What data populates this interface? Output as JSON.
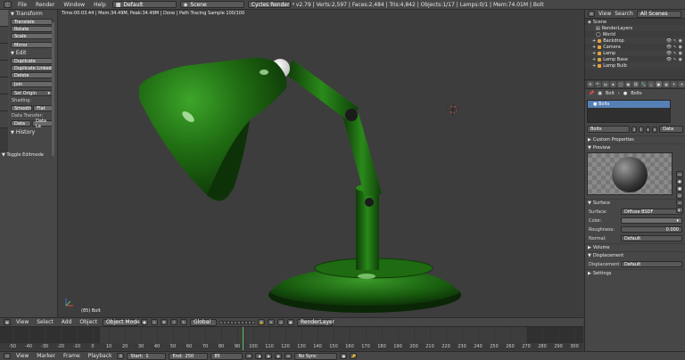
{
  "top": {
    "menu": [
      "File",
      "Render",
      "Window",
      "Help"
    ],
    "screen_layout": "Default",
    "scene": "Scene",
    "engine": "Cycles Render",
    "stats": "v2.79 | Verts:2,597 | Faces:2,484 | Tris:4,842 | Objects:1/17 | Lamps:0/1 | Mem:74.01M | Bolt"
  },
  "toolshelf": {
    "transform_head": "Transform",
    "translate": "Translate",
    "rotate": "Rotate",
    "scale": "Scale",
    "mirror": "Mirror",
    "edit_head": "Edit",
    "duplicate": "Duplicate",
    "duplicate_linked": "Duplicate Linked",
    "delete": "Delete",
    "join": "Join",
    "set_origin": "Set Origin",
    "shading": "Shading:",
    "smooth": "Smooth",
    "flat": "Flat",
    "data_transfer": "Data Transfer:",
    "data": "Data",
    "data_layout": "Data La",
    "history_head": "History",
    "toggle_editmode": "Toggle Editmode"
  },
  "viewport": {
    "info": "Time:00:03.44 | Mem:34.49M, Peak:34.49M | Done | Path Tracing Sample 100/100",
    "object_label": "(85) Bolt"
  },
  "header3d": {
    "view": "View",
    "select": "Select",
    "add": "Add",
    "object": "Object",
    "mode": "Object Mode",
    "orientation": "Global",
    "render_layer": "RenderLayer"
  },
  "timeline": {
    "ticks": [
      "-50",
      "-40",
      "-30",
      "-20",
      "-10",
      "0",
      "10",
      "20",
      "30",
      "40",
      "50",
      "60",
      "70",
      "80",
      "90",
      "100",
      "110",
      "120",
      "130",
      "140",
      "150",
      "160",
      "170",
      "180",
      "190",
      "200",
      "210",
      "220",
      "230",
      "240",
      "250",
      "260",
      "270",
      "280",
      "290",
      "300"
    ]
  },
  "bottom": {
    "view": "View",
    "marker": "Marker",
    "frame": "Frame",
    "playback": "Playback",
    "start_label": "Start:",
    "start": "1",
    "end_label": "End:",
    "end": "250",
    "current": "85",
    "sync": "No Sync"
  },
  "outliner": {
    "view": "View",
    "search": "Search",
    "filter": "All Scenes",
    "rows": [
      "Scene",
      "RenderLayers",
      "World",
      "Backdrop",
      "Camera",
      "Lamp",
      "Lamp Base",
      "Lamp Bulb"
    ]
  },
  "properties": {
    "crumb_object": "Bolt",
    "crumb_material": "Bolts",
    "material_slot": "Bolts",
    "material_name": "Bolts",
    "users": "3",
    "link": "Data",
    "custom_props": "Custom Properties",
    "preview": "Preview",
    "surface": "Surface",
    "surface_label": "Surface:",
    "surface_val": "Diffuse BSDF",
    "color_label": "Color:",
    "roughness_label": "Roughness:",
    "roughness_val": "0.000",
    "normal_label": "Normal:",
    "normal_val": "Default",
    "volume": "Volume",
    "displacement": "Displacement",
    "displacement_label": "Displacement:",
    "displacement_val": "Default",
    "settings": "Settings"
  },
  "colors": {
    "lamp_green": "#1f6b12",
    "accent_blue": "#5580b6",
    "frame_cursor": "#5cc15c"
  }
}
